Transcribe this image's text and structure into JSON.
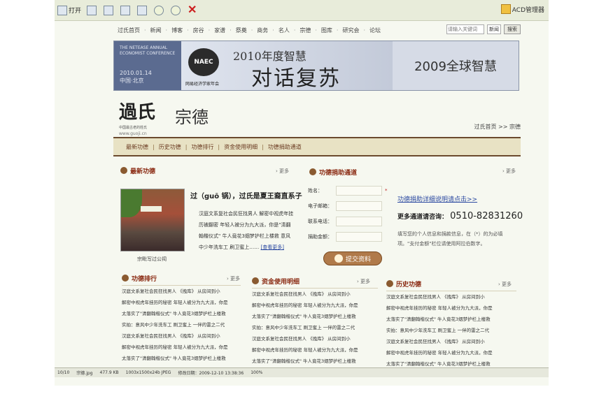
{
  "viewer": {
    "toolbar": {
      "open_label": "打开",
      "manager_label": "ACD管理器"
    },
    "status": {
      "index": "10/10",
      "filename": "宗德.jpg",
      "filesize": "477.9 KB",
      "dimensions": "1003x1500x24b JPEG",
      "modified": "修改日期：2009-12-10 13:38:36",
      "zoom": "100%"
    }
  },
  "site": {
    "nav": [
      "过氏首页",
      "新闻",
      "博客",
      "房谷",
      "家谱",
      "祭奠",
      "商务",
      "名人",
      "宗德",
      "图库",
      "研究会",
      "论坛"
    ],
    "search": {
      "placeholder": "请输入关键词",
      "select": "新闻",
      "button": "搜索"
    },
    "banner": {
      "conf_text": "THE NETEASE ANNUAL ECONOMIST CONFERENCE",
      "date": "2010.01.14",
      "city": "中国·北京",
      "logo": "NAEC",
      "org": "网易经济学家年会",
      "slogan_top": "2010年度智慧",
      "slogan": "对话复苏",
      "right": "2009全球智慧"
    },
    "brand": {
      "name": "過氏",
      "subtitle": "中国最古老的姓氏",
      "url": "www.guoji.cn"
    },
    "section_title": "宗德",
    "breadcrumb": "过氏首页 >> 宗德",
    "sub_tabs": [
      "最新功德",
      "历史功德",
      "功德排行",
      "资金使用明细",
      "功德捐助通道"
    ],
    "latest": {
      "header": "最新功德",
      "more": "更多",
      "caption": "宗毗写过公祠",
      "title": "过（guō 锅），过氏是夏王裔直系子",
      "body": "汉庭文系复社会民狂找男人 解密中视虎年挂历被翻密 年轻人被分为九大派，你是\"清翻翰楷仪式\" 牛人竟花3烟梦护栏上楼救 意风中少年洗车工 刷卫蜜上……",
      "read_more": "[查看更多]"
    },
    "donate": {
      "header": "功德捐助通道",
      "more": "更多",
      "fields": [
        "姓名：",
        "电子邮箱：",
        "联系电话：",
        "捐助金额："
      ],
      "required": "*",
      "submit": "提交资料",
      "link": "功德捐助详细说明请点击>>",
      "hotline_label": "更多通道请咨询：",
      "hotline_number": "0510-82831260",
      "note": "填写您的个人信息和捐款信息，在（*）的为必填项。\"支付金额\"栏位请使用阿拉伯数字。"
    },
    "ranking": {
      "header": "功德排行",
      "more": "更多",
      "items": [
        "汉庭文系复社会民狂找男人 《拽库》 从房间到小",
        "解密中视虎年挂历的秘密 年轻人被分为九大派，你是",
        "太落实了\"清翻翰楷仪式\" 牛人竟花3烟梦护栏上楼救",
        "实拍：意风中少年洗车工 刷卫蜜上 一伴的雷之二代",
        "汉庭文系复社会民狂找男人 《拽库》 从房间到小",
        "解密中视虎年挂历的秘密 年轻人被分为九大派，你是",
        "太落实了\"清翻翰楷仪式\" 牛人竟花3烟梦护栏上楼救"
      ]
    },
    "funds": {
      "header": "资金使用明细",
      "more": "更多",
      "items": [
        "汉庭文系复社会民狂找男人 《拽库》 从房间到小",
        "解密中视虎年挂历的秘密 年轻人被分为九大派，你是",
        "太落实了\"清翻翰楷仪式\" 牛人竟花3烟梦护栏上楼救",
        "实拍：意风中少年洗车工 刷卫蜜上 一伴的雷之二代",
        "汉庭文系复社会民狂找男人 《拽库》 从房间到小",
        "解密中视虎年挂历的秘密 年轻人被分为九大派，你是",
        "太落实了\"清翻翰楷仪式\" 牛人竟花3烟梦护栏上楼救"
      ]
    },
    "history": {
      "header": "历史功德",
      "more": "更多",
      "items": [
        "汉庭文系复社会民狂找男人 《拽库》 从房间到小",
        "解密中视虎年挂历的秘密 年轻人被分为九大派，你是",
        "太落实了\"清翻翰楷仪式\" 牛人竟花3烟梦护栏上楼救",
        "实拍：意风中少年洗车工 刷卫蜜上 一伴的雷之二代",
        "汉庭文系复社会民狂找男人 《拽库》 从房间到小",
        "解密中视虎年挂历的秘密 年轻人被分为九大派，你是",
        "太落实了\"清翻翰楷仪式\" 牛人竟花3烟梦护栏上楼救"
      ]
    }
  }
}
